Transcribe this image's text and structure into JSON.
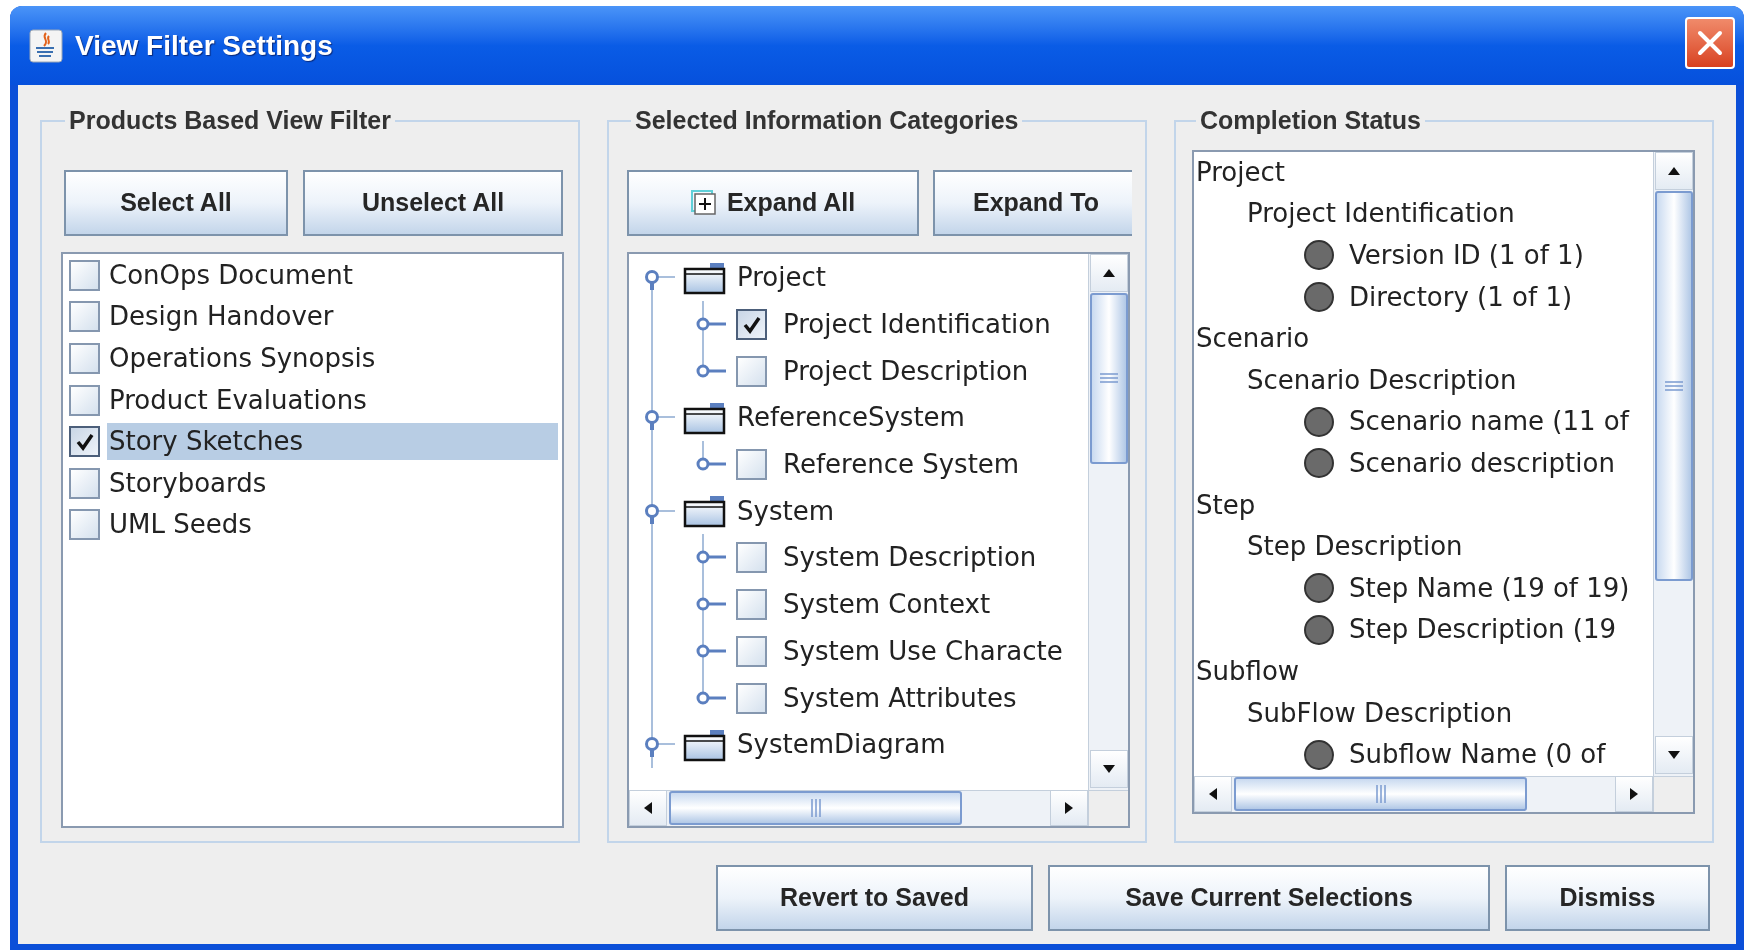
{
  "window": {
    "title": "View Filter Settings"
  },
  "products_panel": {
    "title": "Products Based View Filter",
    "buttons": [
      "Select All",
      "Unselect All"
    ],
    "items": [
      {
        "label": "ConOps Document",
        "checked": false,
        "selected": false
      },
      {
        "label": "Design Handover",
        "checked": false,
        "selected": false
      },
      {
        "label": "Operations Synopsis",
        "checked": false,
        "selected": false
      },
      {
        "label": "Product Evaluations",
        "checked": false,
        "selected": false
      },
      {
        "label": "Story Sketches",
        "checked": true,
        "selected": true
      },
      {
        "label": "Storyboards",
        "checked": false,
        "selected": false
      },
      {
        "label": "UML Seeds",
        "checked": false,
        "selected": false
      }
    ]
  },
  "categories_panel": {
    "title": "Selected Information Categories",
    "buttons": [
      {
        "label": "Expand All",
        "kind": "expand"
      },
      {
        "label": "Expand To",
        "kind": "plain"
      }
    ],
    "tree": [
      {
        "label": "Project",
        "kind": "folder",
        "children": [
          {
            "label": "Project Identification",
            "kind": "leaf",
            "checked": true
          },
          {
            "label": "Project Description",
            "kind": "leaf",
            "checked": false
          }
        ]
      },
      {
        "label": "ReferenceSystem",
        "kind": "folder",
        "children": [
          {
            "label": "Reference System",
            "kind": "leaf",
            "checked": false
          }
        ]
      },
      {
        "label": "System",
        "kind": "folder",
        "children": [
          {
            "label": "System Description",
            "kind": "leaf",
            "checked": false
          },
          {
            "label": "System Context",
            "kind": "leaf",
            "checked": false
          },
          {
            "label": "System Use Characte",
            "kind": "leaf",
            "checked": false
          },
          {
            "label": "System Attributes",
            "kind": "leaf",
            "checked": false
          }
        ]
      },
      {
        "label": "SystemDiagram",
        "kind": "folder"
      }
    ]
  },
  "completion_panel": {
    "title": "Completion Status",
    "tree": [
      {
        "label": "Project",
        "children": [
          {
            "label": "Project Identification",
            "children": [
              {
                "label": "Version ID (1 of 1)"
              },
              {
                "label": "Directory (1 of 1)"
              }
            ]
          }
        ]
      },
      {
        "label": "Scenario",
        "children": [
          {
            "label": "Scenario Description",
            "children": [
              {
                "label": "Scenario name (11 of"
              },
              {
                "label": "Scenario description"
              }
            ]
          }
        ]
      },
      {
        "label": "Step",
        "children": [
          {
            "label": "Step Description",
            "children": [
              {
                "label": "Step Name (19 of 19)"
              },
              {
                "label": "Step Description (19"
              }
            ]
          }
        ]
      },
      {
        "label": "Subflow",
        "children": [
          {
            "label": "SubFlow Description",
            "children": [
              {
                "label": "Subflow Name (0 of"
              }
            ]
          }
        ]
      }
    ]
  },
  "actions": [
    "Revert to Saved",
    "Save Current Selections",
    "Dismiss"
  ]
}
